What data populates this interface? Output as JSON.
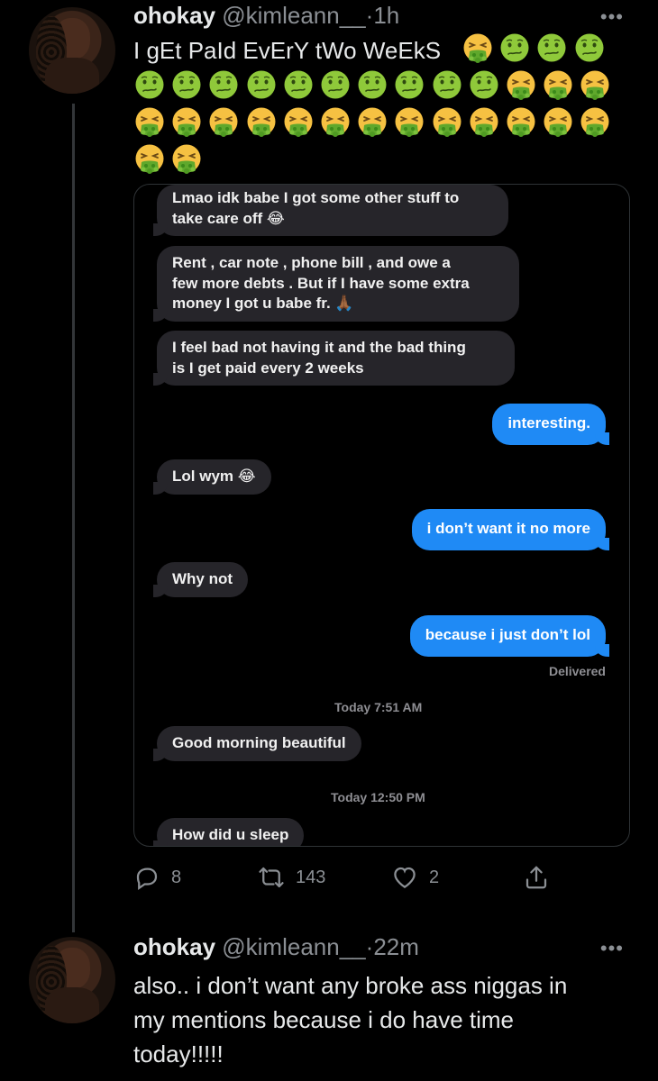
{
  "tweets": [
    {
      "name": "ohokay",
      "handle": "@kimleann__",
      "dot": "·",
      "time": "1h",
      "more": "•••",
      "text": "I gEt PaId EvErY tWo WeEkS",
      "emojis": [
        "nauseated-face-icon",
        "vomiting-face-icon"
      ],
      "emoji_sequence": [
        "vomiting",
        "nauseated",
        "nauseated",
        "nauseated",
        "nauseated",
        "nauseated",
        "nauseated",
        "nauseated",
        "nauseated",
        "nauseated",
        "nauseated",
        "nauseated",
        "nauseated",
        "vomiting",
        "vomiting",
        "vomiting",
        "vomiting",
        "vomiting",
        "vomiting",
        "vomiting",
        "vomiting",
        "vomiting",
        "vomiting",
        "vomiting",
        "vomiting",
        "vomiting",
        "vomiting",
        "vomiting",
        "vomiting"
      ],
      "actions": {
        "replies": "8",
        "retweets": "143",
        "likes": "2"
      }
    },
    {
      "name": "ohokay",
      "handle": "@kimleann__",
      "dot": "·",
      "time": "22m",
      "more": "•••",
      "text_lines": [
        "also.. i don’t want any broke ass niggas in",
        "my mentions because i do have time",
        "today!!!!!"
      ]
    }
  ],
  "conversation": {
    "messages": [
      {
        "side": "received",
        "lines": [
          "Lmao idk babe I got some other stuff to",
          "take care off 😂"
        ]
      },
      {
        "side": "received",
        "lines": [
          "Rent , car note , phone bill , and owe a",
          "few more debts . But if I have some extra",
          "money I got u babe fr. 🙏🏾"
        ]
      },
      {
        "side": "received",
        "lines": [
          "I feel bad not having it and the bad thing",
          "is I get paid every 2 weeks"
        ]
      },
      {
        "side": "sent",
        "lines": [
          "interesting."
        ]
      },
      {
        "side": "received",
        "lines": [
          "Lol wym 😂"
        ]
      },
      {
        "side": "sent",
        "lines": [
          "i don’t want it no more"
        ]
      },
      {
        "side": "received",
        "lines": [
          "Why not"
        ]
      },
      {
        "side": "sent",
        "lines": [
          "because i just don’t lol"
        ]
      },
      {
        "side": "received",
        "lines": [
          "Good morning beautiful"
        ]
      },
      {
        "side": "received",
        "lines": [
          "How did u sleep"
        ]
      }
    ],
    "delivered": "Delivered",
    "timestamps": [
      "Today 7:51 AM",
      "Today 12:50 PM"
    ]
  },
  "colors": {
    "background": "#000000",
    "sent_bubble": "#1f8af5",
    "received_bubble": "#26252a",
    "muted_text": "#8b8f94"
  }
}
